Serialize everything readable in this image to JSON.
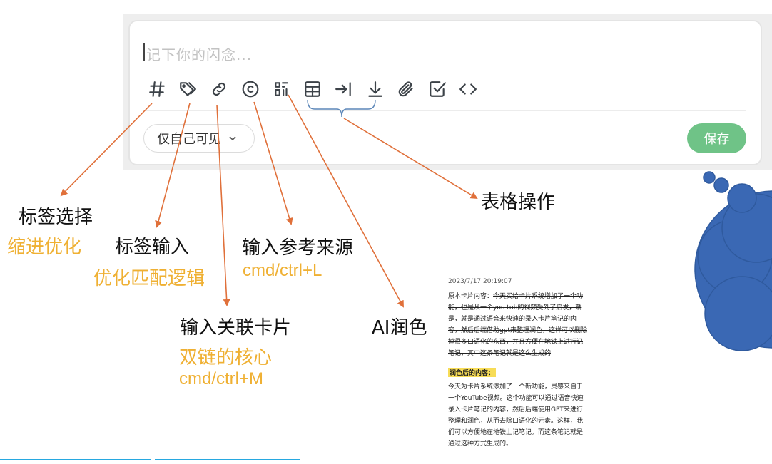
{
  "editor": {
    "placeholder": "记下你的闪念...",
    "visibility": "仅自己可见",
    "save_label": "保存",
    "toolbar_icons": [
      "hash-icon",
      "tags-icon",
      "link-icon",
      "copyright-icon",
      "ai-sparkle-icon",
      "table-icon",
      "indent-icon",
      "download-icon",
      "paperclip-icon",
      "checkbox-icon",
      "code-icon"
    ]
  },
  "annotations": {
    "tag_select": "标签选择",
    "indent_opt": "缩进优化",
    "tag_input": "标签输入",
    "match_opt": "优化匹配逻辑",
    "ref_source": "输入参考来源",
    "ref_shortcut": "cmd/ctrl+L",
    "link_card": "输入关联卡片",
    "link_core": "双链的核心",
    "link_shortcut": "cmd/ctrl+M",
    "ai_polish": "AI润色",
    "table_ops": "表格操作"
  },
  "note": {
    "timestamp": "2023/7/17 20:19:07",
    "orig_label": "原本卡片内容：",
    "orig_text": "今天买给卡片系统增加了一个功能，也是从一个you tub的视频受到了启发，就是，就是通过语音来快速的录入卡片笔记的内容，然后后端借助gpt来整理润色，这样可以删除掉很多口语化的东西，并且方便在地铁上进行记笔记，其中这条笔记就是这么生成的",
    "polished_label": "润色后的内容：",
    "polished_text": "今天为卡片系统添加了一个新功能，灵感来自于一个YouTube视频。这个功能可以通过语音快速录入卡片笔记的内容，然后后端使用GPT来进行整理和润色，从而去除口语化的元素。这样，我们可以方便地在地铁上记笔记。而这条笔记就是通过这种方式生成的。"
  },
  "colors": {
    "accent_green": "#6fc387",
    "arrow_orange": "#e0703a",
    "highlight_yellow": "#efb033",
    "blob_blue": "#3a68b4"
  }
}
